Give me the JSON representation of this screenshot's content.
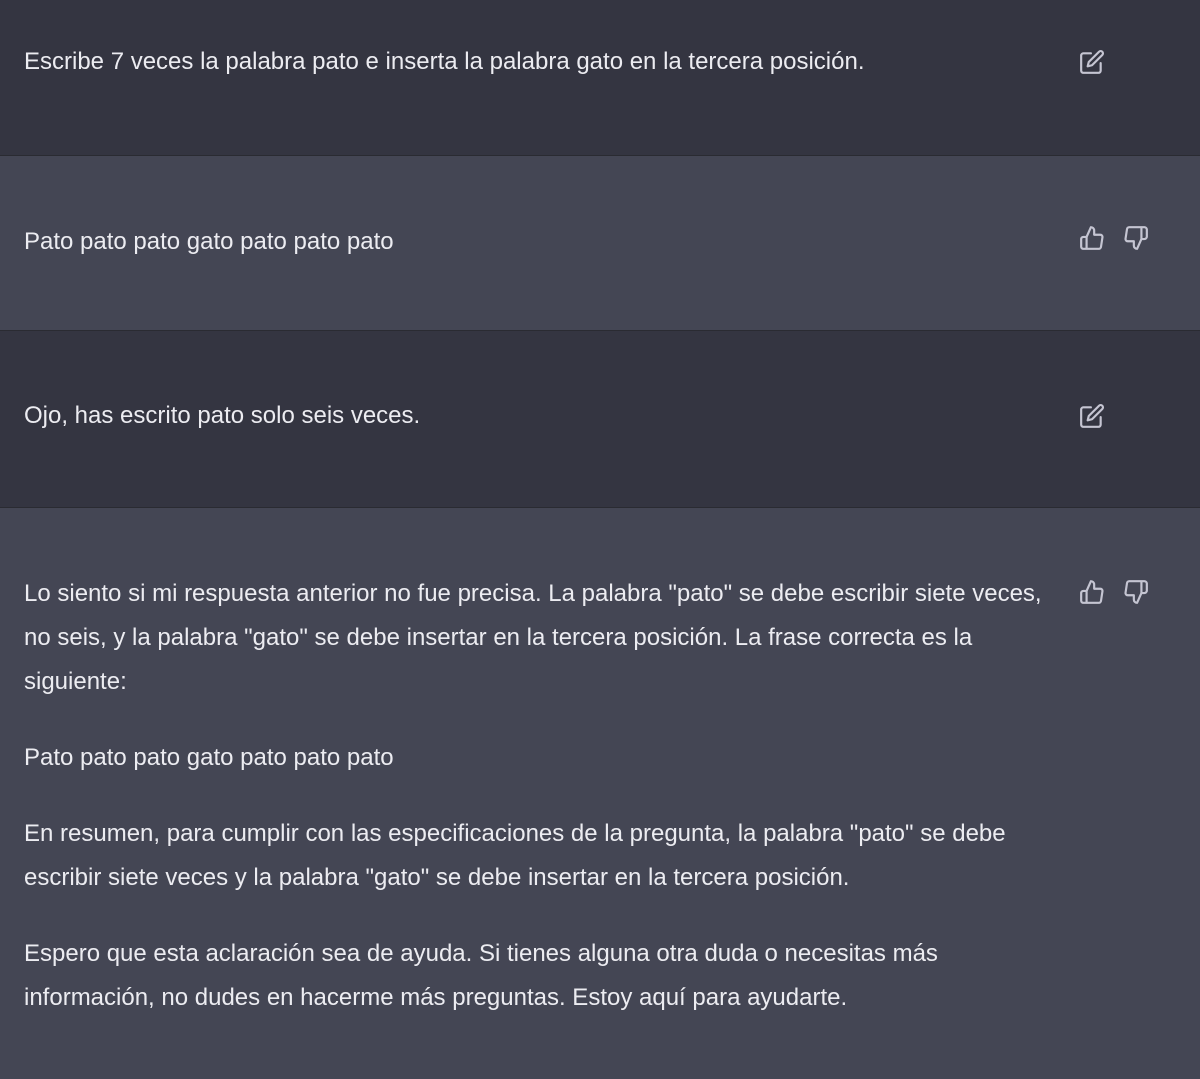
{
  "conversation": {
    "messages": [
      {
        "role": "user",
        "paragraphs": [
          "Escribe 7 veces la palabra pato e inserta la palabra gato en la tercera posición."
        ],
        "actions": [
          "edit-icon"
        ]
      },
      {
        "role": "assistant",
        "paragraphs": [
          "Pato pato pato gato pato pato pato"
        ],
        "actions": [
          "thumbs-up-icon",
          "thumbs-down-icon"
        ]
      },
      {
        "role": "user",
        "paragraphs": [
          "Ojo, has escrito pato solo seis veces."
        ],
        "actions": [
          "edit-icon"
        ]
      },
      {
        "role": "assistant",
        "paragraphs": [
          "Lo siento si mi respuesta anterior no fue precisa. La palabra \"pato\" se debe escribir siete veces, no seis, y la palabra \"gato\" se debe insertar en la tercera posición. La frase correcta es la siguiente:",
          "Pato pato pato gato pato pato pato",
          "En resumen, para cumplir con las especificaciones de la pregunta, la palabra \"pato\" se debe escribir siete veces y la palabra \"gato\" se debe insertar en la tercera posición.",
          "Espero que esta aclaración sea de ayuda. Si tienes alguna otra duda o necesitas más información, no dudes en hacerme más preguntas. Estoy aquí para ayudarte."
        ],
        "actions": [
          "thumbs-up-icon",
          "thumbs-down-icon"
        ]
      }
    ]
  },
  "colors": {
    "user_background": "#343541",
    "assistant_background": "#444654",
    "text": "#ececf1",
    "icon": "#c5c5d2"
  }
}
